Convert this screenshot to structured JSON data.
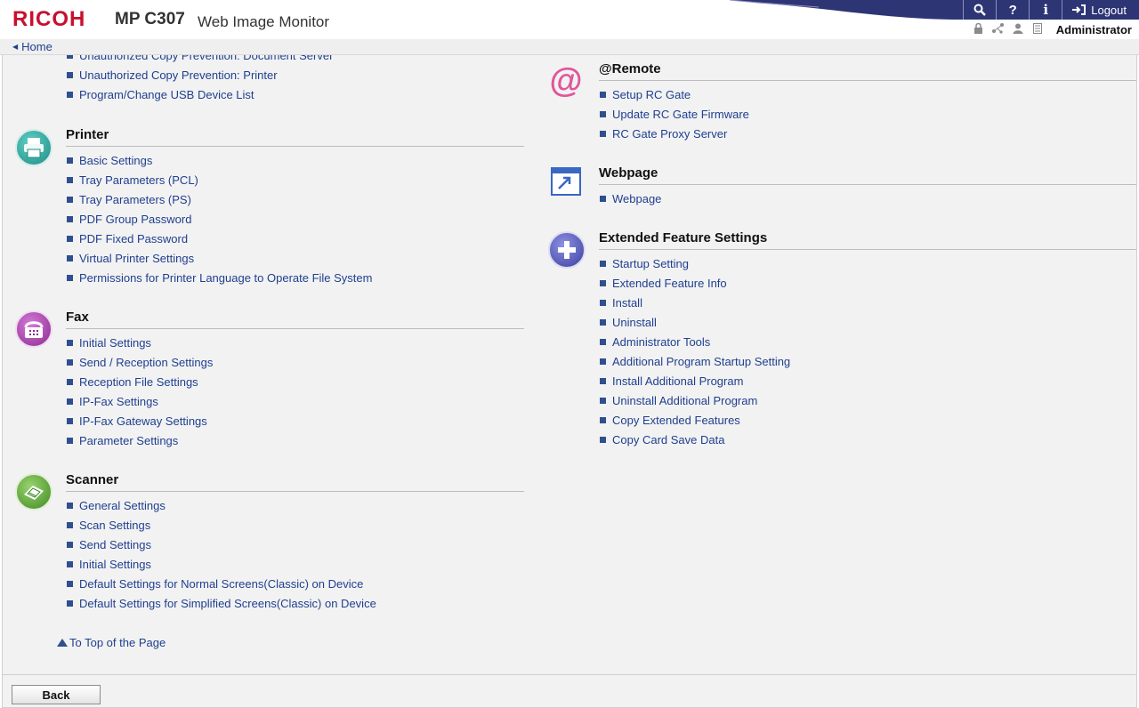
{
  "header": {
    "brand": "RICOH",
    "model": "MP C307",
    "app_name": "Web Image Monitor",
    "logout_label": "Logout",
    "user": "Administrator",
    "home_label": "Home"
  },
  "left_top_items": [
    "Unauthorized Copy Prevention: Document Server",
    "Unauthorized Copy Prevention: Printer",
    "Program/Change USB Device List"
  ],
  "printer": {
    "title": "Printer",
    "items": [
      "Basic Settings",
      "Tray Parameters (PCL)",
      "Tray Parameters (PS)",
      "PDF Group Password",
      "PDF Fixed Password",
      "Virtual Printer Settings",
      "Permissions for Printer Language to Operate File System"
    ]
  },
  "fax": {
    "title": "Fax",
    "items": [
      "Initial Settings",
      "Send / Reception Settings",
      "Reception File Settings",
      "IP-Fax Settings",
      "IP-Fax Gateway Settings",
      "Parameter Settings"
    ]
  },
  "scanner": {
    "title": "Scanner",
    "items": [
      "General Settings",
      "Scan Settings",
      "Send Settings",
      "Initial Settings",
      "Default Settings for Normal Screens(Classic) on Device",
      "Default Settings for Simplified Screens(Classic) on Device"
    ]
  },
  "remote": {
    "title": "@Remote",
    "items": [
      "Setup RC Gate",
      "Update RC Gate Firmware",
      "RC Gate Proxy Server"
    ]
  },
  "webpage": {
    "title": "Webpage",
    "items": [
      "Webpage"
    ]
  },
  "extended": {
    "title": "Extended Feature Settings",
    "items": [
      "Startup Setting",
      "Extended Feature Info",
      "Install",
      "Uninstall",
      "Administrator Tools",
      "Additional Program Startup Setting",
      "Install Additional Program",
      "Uninstall Additional Program",
      "Copy Extended Features",
      "Copy Card Save Data"
    ]
  },
  "to_top_label": "To Top of the Page",
  "back_label": "Back",
  "colors": {
    "brand_red": "#c8102e",
    "link_blue": "#1f3f8f",
    "topbar_navy": "#2e3575",
    "printer_icon": "#2aa39a",
    "fax_icon": "#a43fa8",
    "scanner_icon": "#5fa83a",
    "extended_icon": "#4a4fae"
  },
  "icons": {
    "search": "search-icon",
    "help": "help-icon",
    "info": "info-icon",
    "logout": "logout-icon"
  }
}
